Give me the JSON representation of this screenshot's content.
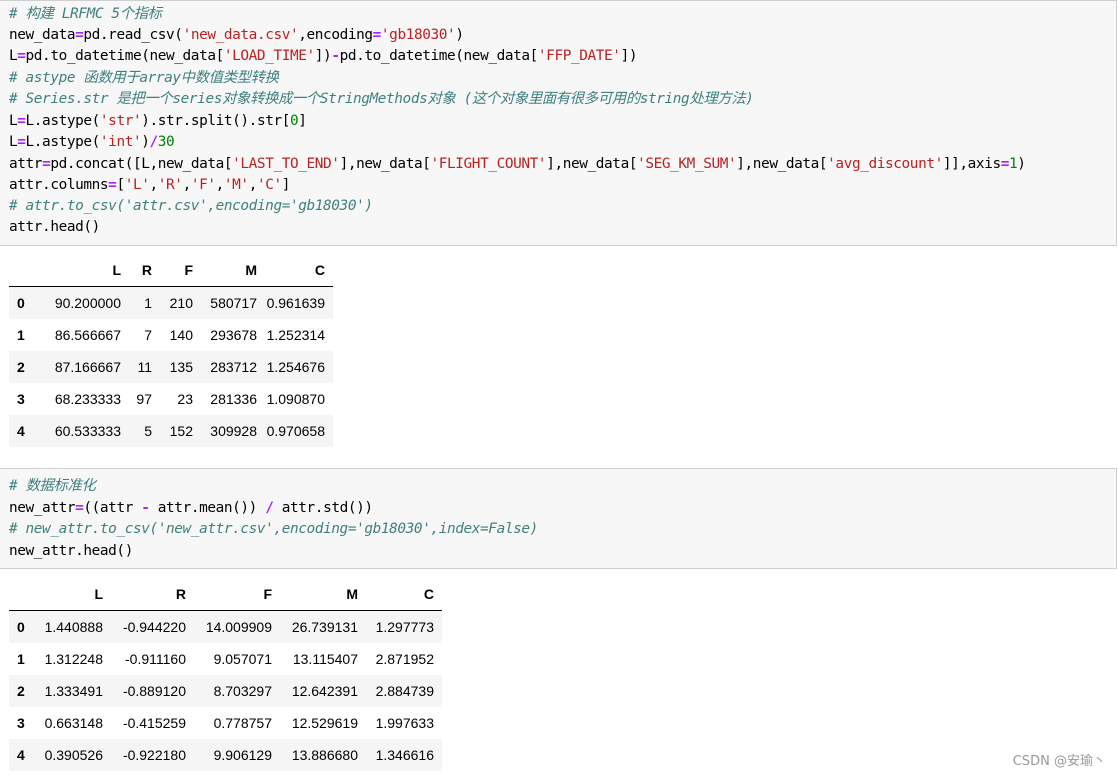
{
  "cell1": {
    "lines": [
      "# 构建 LRFMC 5个指标",
      "new_data=pd.read_csv('new_data.csv',encoding='gb18030')",
      "L=pd.to_datetime(new_data['LOAD_TIME'])-pd.to_datetime(new_data['FFP_DATE'])",
      "# astype 函数用于array中数值类型转换",
      "# Series.str 是把一个series对象转换成一个StringMethods对象 (这个对象里面有很多可用的string处理方法)",
      "L=L.astype('str').str.split().str[0]",
      "L=L.astype('int')/30",
      "attr=pd.concat([L,new_data['LAST_TO_END'],new_data['FLIGHT_COUNT'],new_data['SEG_KM_SUM'],new_data['avg_discount']],axis=1)",
      "attr.columns=['L','R','F','M','C']",
      "# attr.to_csv('attr.csv',encoding='gb18030')",
      "attr.head()"
    ]
  },
  "table1": {
    "columns": [
      "",
      "L",
      "R",
      "F",
      "M",
      "C"
    ],
    "rows": [
      [
        "0",
        "90.200000",
        "1",
        "210",
        "580717",
        "0.961639"
      ],
      [
        "1",
        "86.566667",
        "7",
        "140",
        "293678",
        "1.252314"
      ],
      [
        "2",
        "87.166667",
        "11",
        "135",
        "283712",
        "1.254676"
      ],
      [
        "3",
        "68.233333",
        "97",
        "23",
        "281336",
        "1.090870"
      ],
      [
        "4",
        "60.533333",
        "5",
        "152",
        "309928",
        "0.970658"
      ]
    ]
  },
  "cell2": {
    "lines": [
      "# 数据标准化",
      "new_attr=((attr - attr.mean()) / attr.std())",
      "# new_attr.to_csv('new_attr.csv',encoding='gb18030',index=False)",
      "new_attr.head()"
    ]
  },
  "table2": {
    "columns": [
      "",
      "L",
      "R",
      "F",
      "M",
      "C"
    ],
    "rows": [
      [
        "0",
        "1.440888",
        "-0.944220",
        "14.009909",
        "26.739131",
        "1.297773"
      ],
      [
        "1",
        "1.312248",
        "-0.911160",
        "9.057071",
        "13.115407",
        "2.871952"
      ],
      [
        "2",
        "1.333491",
        "-0.889120",
        "8.703297",
        "12.642391",
        "2.884739"
      ],
      [
        "3",
        "0.663148",
        "-0.415259",
        "0.778757",
        "12.529619",
        "1.997633"
      ],
      [
        "4",
        "0.390526",
        "-0.922180",
        "9.906129",
        "13.886680",
        "1.346616"
      ]
    ]
  },
  "watermark": "CSDN @安瑜丶",
  "colors": {
    "comment": "#408080",
    "string": "#ba2121",
    "operator": "#aa22ff",
    "number": "#008000",
    "cell_bg": "#f7f7f7",
    "cell_border": "#cfcfcf",
    "row_stripe": "#f5f5f5"
  }
}
